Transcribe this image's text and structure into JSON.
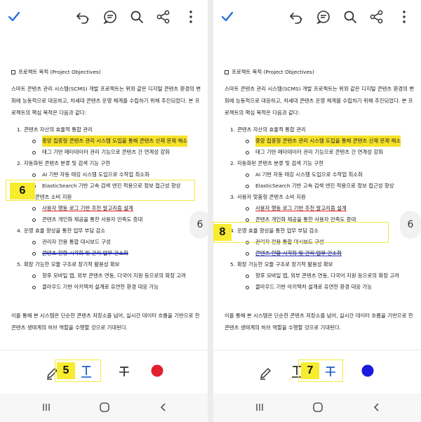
{
  "doc": {
    "section_title": "프로젝트 목적 (Project Objectives)",
    "intro": "스마트 콘텐츠 관리 시스템(SCMS) 개발 프로젝트는 위와 같은 디지털 콘텐츠 환경의 변화에 능동적으로 대응하고, 차세대 콘텐츠 운영 체계를 수립하기 위해 추진되었다. 본 프로젝트의 핵심 목적은 다음과 같다:",
    "items": [
      {
        "num": "1.",
        "text": "콘텐츠 자산의 효율적 통합 관리",
        "sub": [
          "중앙 집중형 콘텐츠 관리 시스템 도입을 통해 콘텐츠 산재 문제 해소",
          "태그 기반 메타데이터 관리 기능으로 콘텐츠 간 연계성 강화"
        ]
      },
      {
        "num": "2.",
        "text": "자동화된 콘텐츠 분류 및 검색 기능 구현",
        "sub": [
          "AI 기반 자동 태깅 시스템 도입으로 수작업 최소화",
          "ElasticSearch 기반 고속 검색 엔진 적용으로 정보 접근성 향상"
        ]
      },
      {
        "num": "3.",
        "text": "사용자 맞춤형 콘텐츠 소비 지원",
        "sub": [
          "사용자 행동 로그 기반 추천 알고리즘 설계",
          "콘텐츠 개인화 제공을 통한 사용자 만족도 증대"
        ]
      },
      {
        "num": "4.",
        "text": "운영 효율 향상을 통한 업무 부담 감소",
        "sub": [
          "관리자 전용 통합 대시보드 구성",
          "콘텐츠 현황 시각화 및 관리 업무 간소화"
        ]
      },
      {
        "num": "5.",
        "text": "확장 가능한 모듈 구조로 장기적 활용성 확보",
        "sub": [
          "향후 모바일 앱, 외부 콘텐츠 연동, 다국어 지원 등으로의 확장 고려",
          "클라우드 기반 아키텍처 설계로 유연한 환경 대응 가능"
        ]
      }
    ],
    "outro": "이를 통해 본 시스템은 단순한 콘텐츠 저장소를 넘어, 실시간 데이터 흐름을 기반으로 한 콘텐츠 생태계의 허브 역할을 수행할 것으로 기대된다."
  },
  "left": {
    "item3_visible_text": "자 맞춤형 콘텐츠 소비 지원",
    "page_number": "6",
    "callout_badge": "6",
    "toolbar_badge": "5",
    "pen_color": "#e0202f"
  },
  "right": {
    "page_number": "6",
    "callout_badge": "8",
    "toolbar_badge": "7",
    "pen_color": "#1a1ae0"
  },
  "colors": {
    "accent": "#1a6ad9",
    "highlight": "#f7e22a",
    "badge": "#f7ec2e"
  }
}
